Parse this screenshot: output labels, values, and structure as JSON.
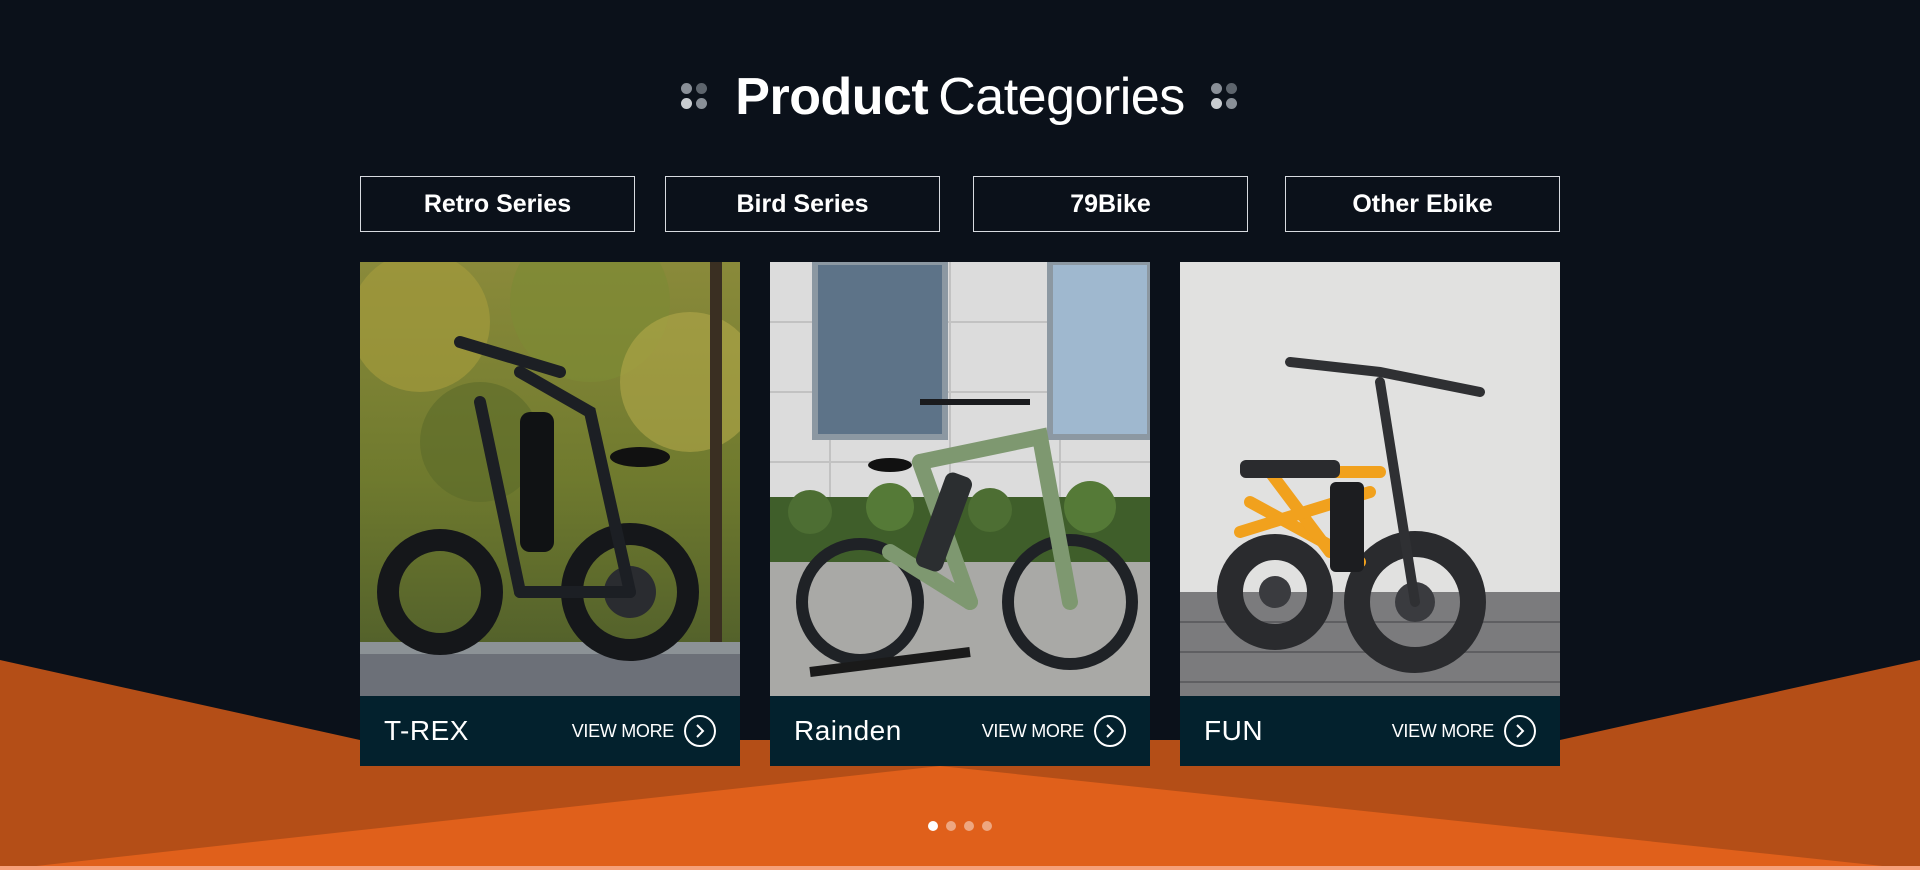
{
  "section": {
    "title_bold": "Product",
    "title_light": "Categories"
  },
  "tabs": [
    {
      "label": "Retro Series"
    },
    {
      "label": "Bird Series"
    },
    {
      "label": "79Bike"
    },
    {
      "label": "Other Ebike"
    }
  ],
  "cards": [
    {
      "name": "T-REX",
      "action": "VIEW MORE",
      "icon": "circle-arrow-right-icon"
    },
    {
      "name": "Rainden",
      "action": "VIEW MORE",
      "icon": "circle-arrow-right-icon"
    },
    {
      "name": "FUN",
      "action": "VIEW MORE",
      "icon": "circle-arrow-right-icon"
    }
  ],
  "pager": {
    "count": 4,
    "active_index": 0
  },
  "colors": {
    "background": "#0b111a",
    "orange_dark": "#b44e17",
    "orange_light": "#e0601b",
    "card_footer": "#03212d"
  }
}
